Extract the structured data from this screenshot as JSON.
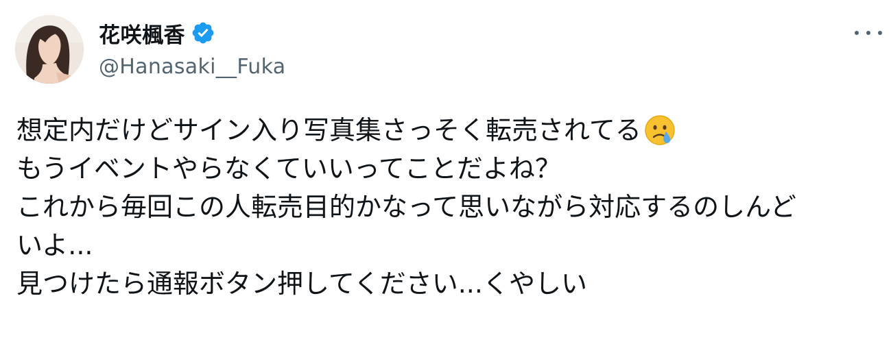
{
  "author": {
    "display_name": "花咲楓香",
    "handle": "@Hanasaki__Fuka",
    "verified": true,
    "verified_icon": "verified-badge-icon",
    "verified_color": "#1d9bf0",
    "avatar_icon": "profile-photo"
  },
  "menu": {
    "icon": "more-options-icon"
  },
  "tweet": {
    "lines": [
      "想定内だけどサイン入り写真集さっそく転売されてる",
      "もうイベントやらなくていいってことだよね？",
      "これから毎回この人転売目的かなって思いながら対応するのしんど",
      "いよ...",
      "見つけたら通報ボタン押してください...くやしい"
    ],
    "emoji": "crying-face-emoji"
  },
  "colors": {
    "text_primary": "#0f1419",
    "text_secondary": "#536471",
    "accent": "#1d9bf0"
  }
}
